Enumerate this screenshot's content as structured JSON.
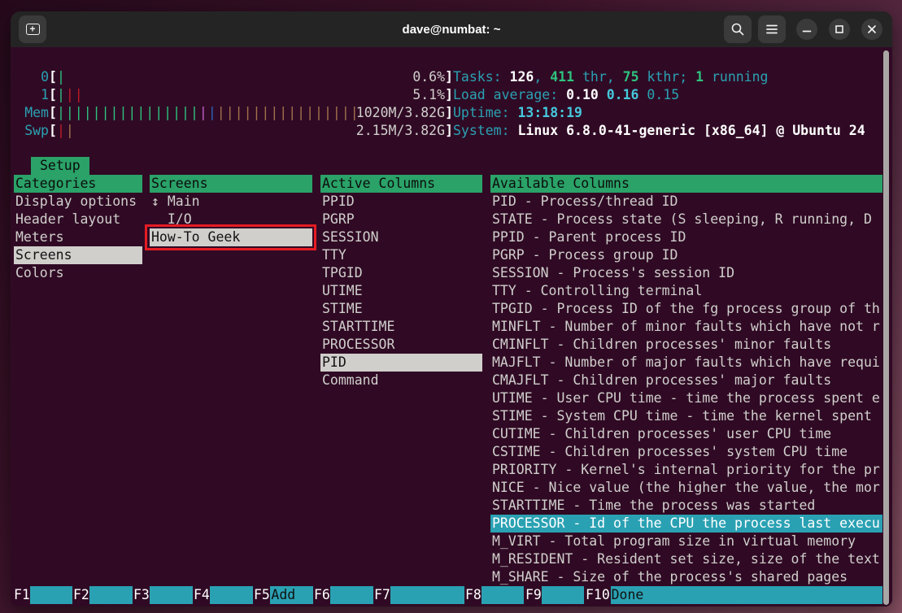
{
  "window": {
    "title": "dave@numbat: ~"
  },
  "titlebar": {
    "icons": [
      "new-tab-icon",
      "search-icon",
      "menu-icon",
      "minimize-icon",
      "maximize-icon",
      "close-icon"
    ]
  },
  "colors": {
    "terminal_bg": "#300a24",
    "foreground": "#d0cfcc",
    "accent_green": "#2aa268",
    "accent_cyan": "#2aa1b3",
    "selection_gray": "#d0cfcc",
    "annotation_red": "#e51c24"
  },
  "header": {
    "meters": [
      {
        "label": "0",
        "value": "0.6%",
        "bars": [
          [
            "green",
            1
          ]
        ]
      },
      {
        "label": "1",
        "value": "5.1%",
        "bars": [
          [
            "green",
            1
          ],
          [
            "red",
            2
          ]
        ]
      },
      {
        "label": "Mem",
        "value": "1020M/3.82G",
        "bars": [
          [
            "green",
            16
          ],
          [
            "magenta",
            1
          ],
          [
            "blue",
            1
          ],
          [
            "yellow",
            23
          ]
        ]
      },
      {
        "label": "Swp",
        "value": "2.15M/3.82G",
        "bars": [
          [
            "red",
            1
          ],
          [
            "yellow",
            1
          ]
        ]
      }
    ],
    "info_lines": [
      [
        {
          "t": "Tasks: ",
          "s": "c"
        },
        {
          "t": "126",
          "s": "w"
        },
        {
          "t": ", ",
          "s": "c"
        },
        {
          "t": "411",
          "s": "g"
        },
        {
          "t": " thr, ",
          "s": "c"
        },
        {
          "t": "75",
          "s": "g"
        },
        {
          "t": " kthr; ",
          "s": "c"
        },
        {
          "t": "1",
          "s": "g"
        },
        {
          "t": " running",
          "s": "c"
        }
      ],
      [
        {
          "t": "Load average: ",
          "s": "c"
        },
        {
          "t": "0.10 ",
          "s": "w"
        },
        {
          "t": "0.16 ",
          "s": "cb"
        },
        {
          "t": "0.15",
          "s": "c"
        }
      ],
      [
        {
          "t": "Uptime: ",
          "s": "c"
        },
        {
          "t": "13:18:19",
          "s": "cb"
        }
      ],
      [
        {
          "t": "System: ",
          "s": "c"
        },
        {
          "t": "Linux 6.8.0-41-generic [x86_64] @ Ubuntu 24",
          "s": "w"
        }
      ]
    ]
  },
  "setup": {
    "tab": "Setup",
    "panels": [
      {
        "title": "Categories",
        "items": [
          {
            "label": "Display options"
          },
          {
            "label": "Header layout"
          },
          {
            "label": "Meters"
          },
          {
            "label": "Screens",
            "selected": true
          },
          {
            "label": "Colors"
          }
        ]
      },
      {
        "title": "Screens",
        "items": [
          {
            "label": "↕ Main"
          },
          {
            "label": "  I/O"
          },
          {
            "label": "How-To Geek",
            "selected": true,
            "annotated": true
          }
        ]
      },
      {
        "title": "Active Columns",
        "items": [
          {
            "label": "PPID"
          },
          {
            "label": "PGRP"
          },
          {
            "label": "SESSION"
          },
          {
            "label": "TTY"
          },
          {
            "label": "TPGID"
          },
          {
            "label": "UTIME"
          },
          {
            "label": "STIME"
          },
          {
            "label": "STARTTIME"
          },
          {
            "label": "PROCESSOR"
          },
          {
            "label": "PID",
            "selected": true
          },
          {
            "label": "Command"
          }
        ]
      },
      {
        "title": "Available Columns",
        "items": [
          {
            "label": "PID - Process/thread ID"
          },
          {
            "label": "STATE - Process state (S sleeping, R running, D"
          },
          {
            "label": "PPID - Parent process ID"
          },
          {
            "label": "PGRP - Process group ID"
          },
          {
            "label": "SESSION - Process's session ID"
          },
          {
            "label": "TTY - Controlling terminal"
          },
          {
            "label": "TPGID - Process ID of the fg process group of th"
          },
          {
            "label": "MINFLT - Number of minor faults which have not r"
          },
          {
            "label": "CMINFLT - Children processes' minor faults"
          },
          {
            "label": "MAJFLT - Number of major faults which have requi"
          },
          {
            "label": "CMAJFLT - Children processes' major faults"
          },
          {
            "label": "UTIME - User CPU time - time the process spent e"
          },
          {
            "label": "STIME - System CPU time - time the kernel spent"
          },
          {
            "label": "CUTIME - Children processes' user CPU time"
          },
          {
            "label": "CSTIME - Children processes' system CPU time"
          },
          {
            "label": "PRIORITY - Kernel's internal priority for the pr"
          },
          {
            "label": "NICE - Nice value (the higher the value, the mor"
          },
          {
            "label": "STARTTIME - Time the process was started"
          },
          {
            "label": "PROCESSOR - Id of the CPU the process last execu",
            "highlight": true
          },
          {
            "label": "M_VIRT - Total program size in virtual memory"
          },
          {
            "label": "M_RESIDENT - Resident set size, size of the text"
          },
          {
            "label": "M_SHARE - Size of the process's shared pages"
          }
        ]
      }
    ]
  },
  "function_bar": {
    "keys": [
      {
        "key": "F1",
        "label": ""
      },
      {
        "key": "F2",
        "label": ""
      },
      {
        "key": "F3",
        "label": ""
      },
      {
        "key": "F4",
        "label": ""
      },
      {
        "key": "F5",
        "label": "Add"
      },
      {
        "key": "F6",
        "label": ""
      },
      {
        "key": "F7",
        "label": ""
      },
      {
        "key": "F8",
        "label": ""
      },
      {
        "key": "F9",
        "label": ""
      },
      {
        "key": "F10",
        "label": "Done"
      }
    ]
  }
}
